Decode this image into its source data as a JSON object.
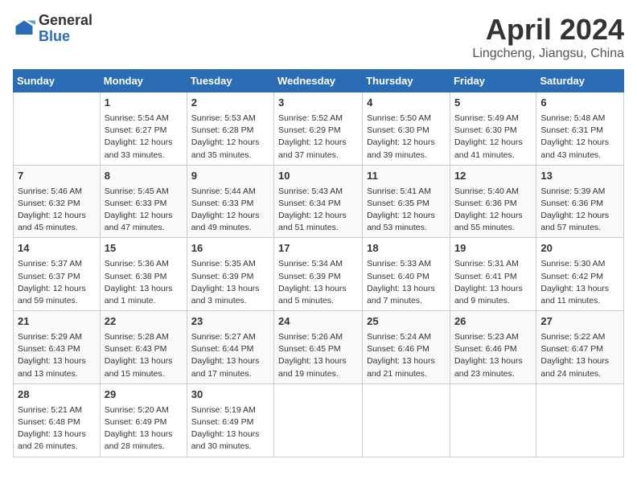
{
  "header": {
    "logo_general": "General",
    "logo_blue": "Blue",
    "title": "April 2024",
    "subtitle": "Lingcheng, Jiangsu, China"
  },
  "days_of_week": [
    "Sunday",
    "Monday",
    "Tuesday",
    "Wednesday",
    "Thursday",
    "Friday",
    "Saturday"
  ],
  "weeks": [
    [
      {
        "day": "",
        "content": ""
      },
      {
        "day": "1",
        "content": "Sunrise: 5:54 AM\nSunset: 6:27 PM\nDaylight: 12 hours\nand 33 minutes."
      },
      {
        "day": "2",
        "content": "Sunrise: 5:53 AM\nSunset: 6:28 PM\nDaylight: 12 hours\nand 35 minutes."
      },
      {
        "day": "3",
        "content": "Sunrise: 5:52 AM\nSunset: 6:29 PM\nDaylight: 12 hours\nand 37 minutes."
      },
      {
        "day": "4",
        "content": "Sunrise: 5:50 AM\nSunset: 6:30 PM\nDaylight: 12 hours\nand 39 minutes."
      },
      {
        "day": "5",
        "content": "Sunrise: 5:49 AM\nSunset: 6:30 PM\nDaylight: 12 hours\nand 41 minutes."
      },
      {
        "day": "6",
        "content": "Sunrise: 5:48 AM\nSunset: 6:31 PM\nDaylight: 12 hours\nand 43 minutes."
      }
    ],
    [
      {
        "day": "7",
        "content": "Sunrise: 5:46 AM\nSunset: 6:32 PM\nDaylight: 12 hours\nand 45 minutes."
      },
      {
        "day": "8",
        "content": "Sunrise: 5:45 AM\nSunset: 6:33 PM\nDaylight: 12 hours\nand 47 minutes."
      },
      {
        "day": "9",
        "content": "Sunrise: 5:44 AM\nSunset: 6:33 PM\nDaylight: 12 hours\nand 49 minutes."
      },
      {
        "day": "10",
        "content": "Sunrise: 5:43 AM\nSunset: 6:34 PM\nDaylight: 12 hours\nand 51 minutes."
      },
      {
        "day": "11",
        "content": "Sunrise: 5:41 AM\nSunset: 6:35 PM\nDaylight: 12 hours\nand 53 minutes."
      },
      {
        "day": "12",
        "content": "Sunrise: 5:40 AM\nSunset: 6:36 PM\nDaylight: 12 hours\nand 55 minutes."
      },
      {
        "day": "13",
        "content": "Sunrise: 5:39 AM\nSunset: 6:36 PM\nDaylight: 12 hours\nand 57 minutes."
      }
    ],
    [
      {
        "day": "14",
        "content": "Sunrise: 5:37 AM\nSunset: 6:37 PM\nDaylight: 12 hours\nand 59 minutes."
      },
      {
        "day": "15",
        "content": "Sunrise: 5:36 AM\nSunset: 6:38 PM\nDaylight: 13 hours\nand 1 minute."
      },
      {
        "day": "16",
        "content": "Sunrise: 5:35 AM\nSunset: 6:39 PM\nDaylight: 13 hours\nand 3 minutes."
      },
      {
        "day": "17",
        "content": "Sunrise: 5:34 AM\nSunset: 6:39 PM\nDaylight: 13 hours\nand 5 minutes."
      },
      {
        "day": "18",
        "content": "Sunrise: 5:33 AM\nSunset: 6:40 PM\nDaylight: 13 hours\nand 7 minutes."
      },
      {
        "day": "19",
        "content": "Sunrise: 5:31 AM\nSunset: 6:41 PM\nDaylight: 13 hours\nand 9 minutes."
      },
      {
        "day": "20",
        "content": "Sunrise: 5:30 AM\nSunset: 6:42 PM\nDaylight: 13 hours\nand 11 minutes."
      }
    ],
    [
      {
        "day": "21",
        "content": "Sunrise: 5:29 AM\nSunset: 6:43 PM\nDaylight: 13 hours\nand 13 minutes."
      },
      {
        "day": "22",
        "content": "Sunrise: 5:28 AM\nSunset: 6:43 PM\nDaylight: 13 hours\nand 15 minutes."
      },
      {
        "day": "23",
        "content": "Sunrise: 5:27 AM\nSunset: 6:44 PM\nDaylight: 13 hours\nand 17 minutes."
      },
      {
        "day": "24",
        "content": "Sunrise: 5:26 AM\nSunset: 6:45 PM\nDaylight: 13 hours\nand 19 minutes."
      },
      {
        "day": "25",
        "content": "Sunrise: 5:24 AM\nSunset: 6:46 PM\nDaylight: 13 hours\nand 21 minutes."
      },
      {
        "day": "26",
        "content": "Sunrise: 5:23 AM\nSunset: 6:46 PM\nDaylight: 13 hours\nand 23 minutes."
      },
      {
        "day": "27",
        "content": "Sunrise: 5:22 AM\nSunset: 6:47 PM\nDaylight: 13 hours\nand 24 minutes."
      }
    ],
    [
      {
        "day": "28",
        "content": "Sunrise: 5:21 AM\nSunset: 6:48 PM\nDaylight: 13 hours\nand 26 minutes."
      },
      {
        "day": "29",
        "content": "Sunrise: 5:20 AM\nSunset: 6:49 PM\nDaylight: 13 hours\nand 28 minutes."
      },
      {
        "day": "30",
        "content": "Sunrise: 5:19 AM\nSunset: 6:49 PM\nDaylight: 13 hours\nand 30 minutes."
      },
      {
        "day": "",
        "content": ""
      },
      {
        "day": "",
        "content": ""
      },
      {
        "day": "",
        "content": ""
      },
      {
        "day": "",
        "content": ""
      }
    ]
  ]
}
